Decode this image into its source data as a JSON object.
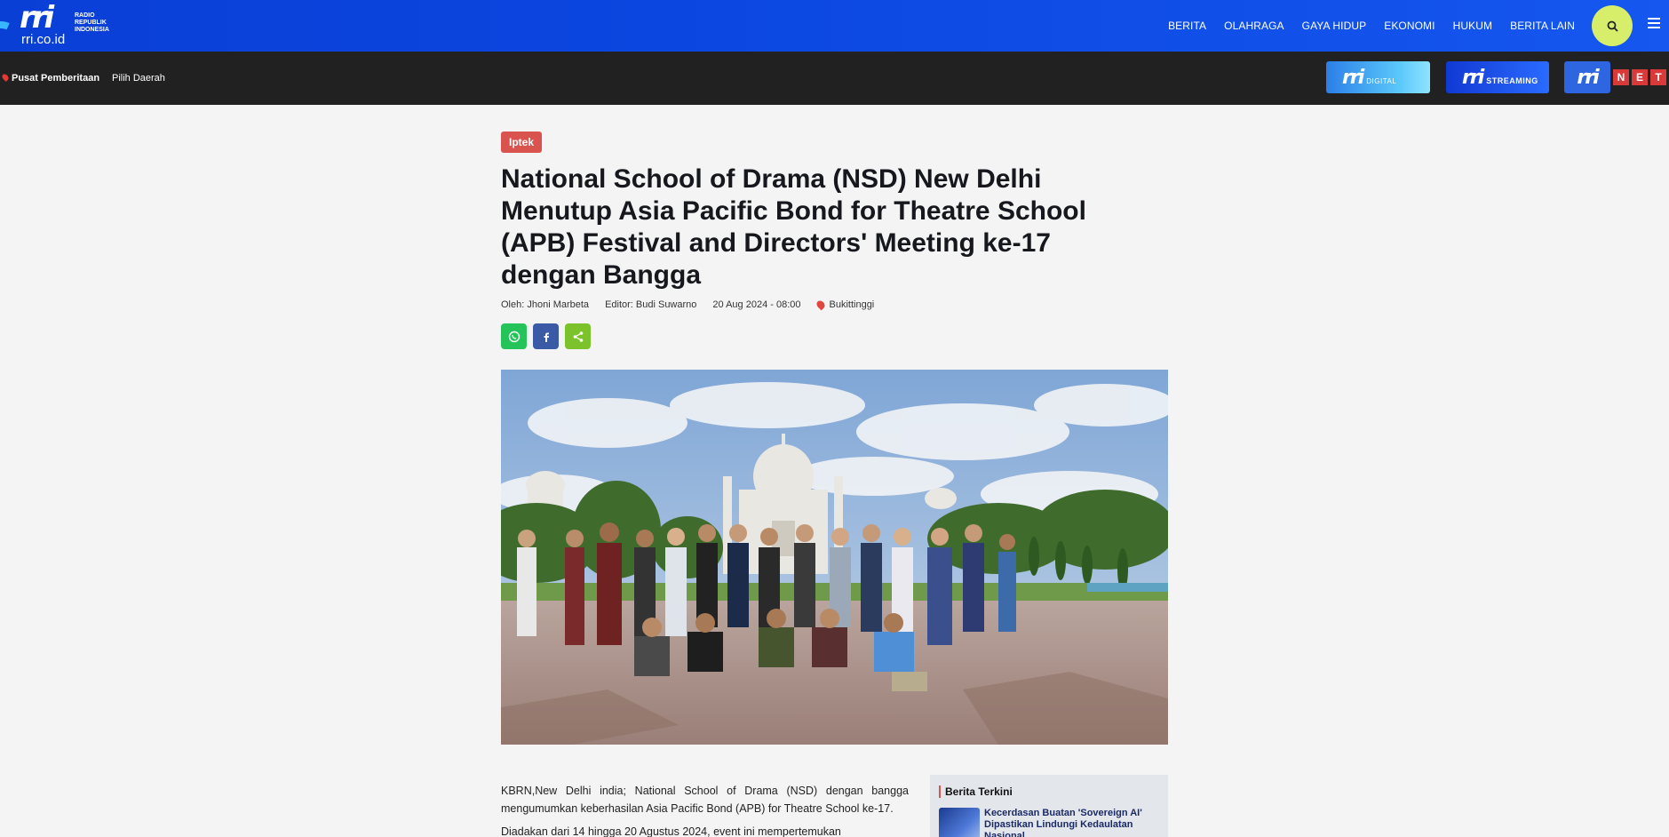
{
  "header": {
    "logo_text": "rri",
    "logo_sub": [
      "RADIO",
      "REPUBLIK",
      "INDONESIA"
    ],
    "domain": "rri.co.id",
    "nav": [
      "BERITA",
      "OLAHRAGA",
      "GAYA HIDUP",
      "EKONOMI",
      "HUKUM",
      "BERITA LAIN"
    ],
    "search_icon": "search-icon",
    "menu_icon": "hamburger-menu-icon"
  },
  "subbar": {
    "primary": "Pusat Pemberitaan",
    "secondary": "Pilih Daerah",
    "badges": {
      "digital": {
        "logo": "rri",
        "sub": "DIGITAL"
      },
      "streaming": {
        "logo": "rri",
        "sub": "STREAMING"
      },
      "net": {
        "logo": "rri",
        "letters": [
          "N",
          "E",
          "T"
        ]
      }
    }
  },
  "article": {
    "category": "Iptek",
    "title": "National School of Drama (NSD) New Delhi Menutup Asia Pacific Bond for Theatre School (APB) Festival and Directors' Meeting ke-17 dengan Bangga",
    "author": "Oleh: Jhoni Marbeta",
    "editor": "Editor: Budi Suwarno",
    "date": "20 Aug 2024 - 08:00",
    "location": "Bukittinggi",
    "paragraphs": [
      "KBRN,New Delhi india; National School of Drama (NSD) dengan bangga mengumumkan keberhasilan Asia Pacific Bond (APB) for Theatre School ke-17.",
      "Diadakan dari 14 hingga 20 Agustus 2024, event ini mempertemukan"
    ]
  },
  "sidebar": {
    "title": "Berita Terkini",
    "item": "Kecerdasan Buatan 'Sovereign AI' Dipastikan Lindungi Kedaulatan Nasional"
  },
  "colors": {
    "nav_blue": "#0b46e0",
    "category_red": "#d9534f",
    "search_yellow": "#d6ee6a"
  }
}
